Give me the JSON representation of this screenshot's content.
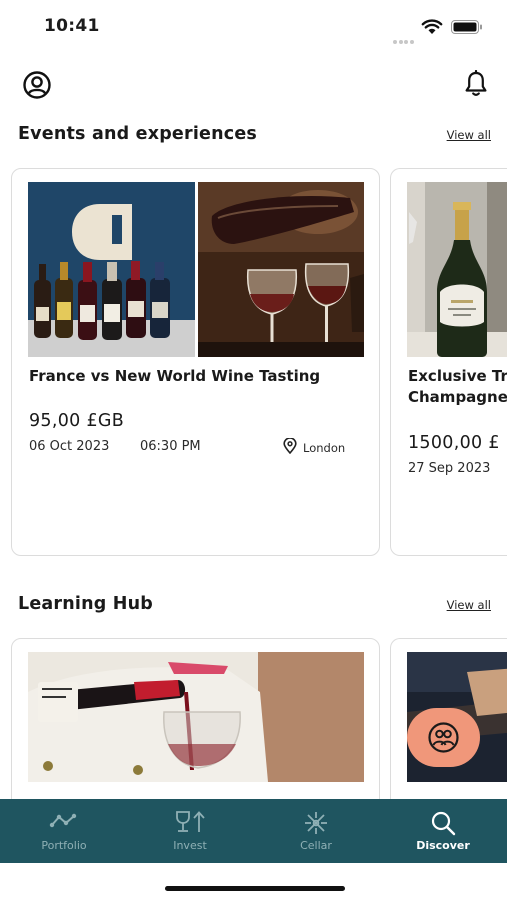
{
  "status_bar": {
    "time": "10:41"
  },
  "events_section": {
    "title": "Events and experiences",
    "view_all": "View all",
    "cards": [
      {
        "title": "France vs New World Wine Tasting",
        "price": "95,00 £GB",
        "date": "06 Oct 2023",
        "time": "06:30 PM",
        "location": "London"
      },
      {
        "title_line1": "Exclusive Tr",
        "title_line2": "Champagne",
        "price": "1500,00 £",
        "date": "27 Sep 2023"
      }
    ]
  },
  "learning_section": {
    "title": "Learning Hub",
    "view_all": "View all"
  },
  "bottom_nav": {
    "items": [
      {
        "label": "Portfolio",
        "icon": "portfolio-chart-icon"
      },
      {
        "label": "Invest",
        "icon": "invest-glass-arrow-icon"
      },
      {
        "label": "Cellar",
        "icon": "cellar-snowflake-icon"
      },
      {
        "label": "Discover",
        "icon": "discover-search-icon",
        "active": true
      }
    ]
  },
  "colors": {
    "nav_background": "#1f5560",
    "fab_background": "#f0977a",
    "card_border": "#dcdcdc"
  }
}
